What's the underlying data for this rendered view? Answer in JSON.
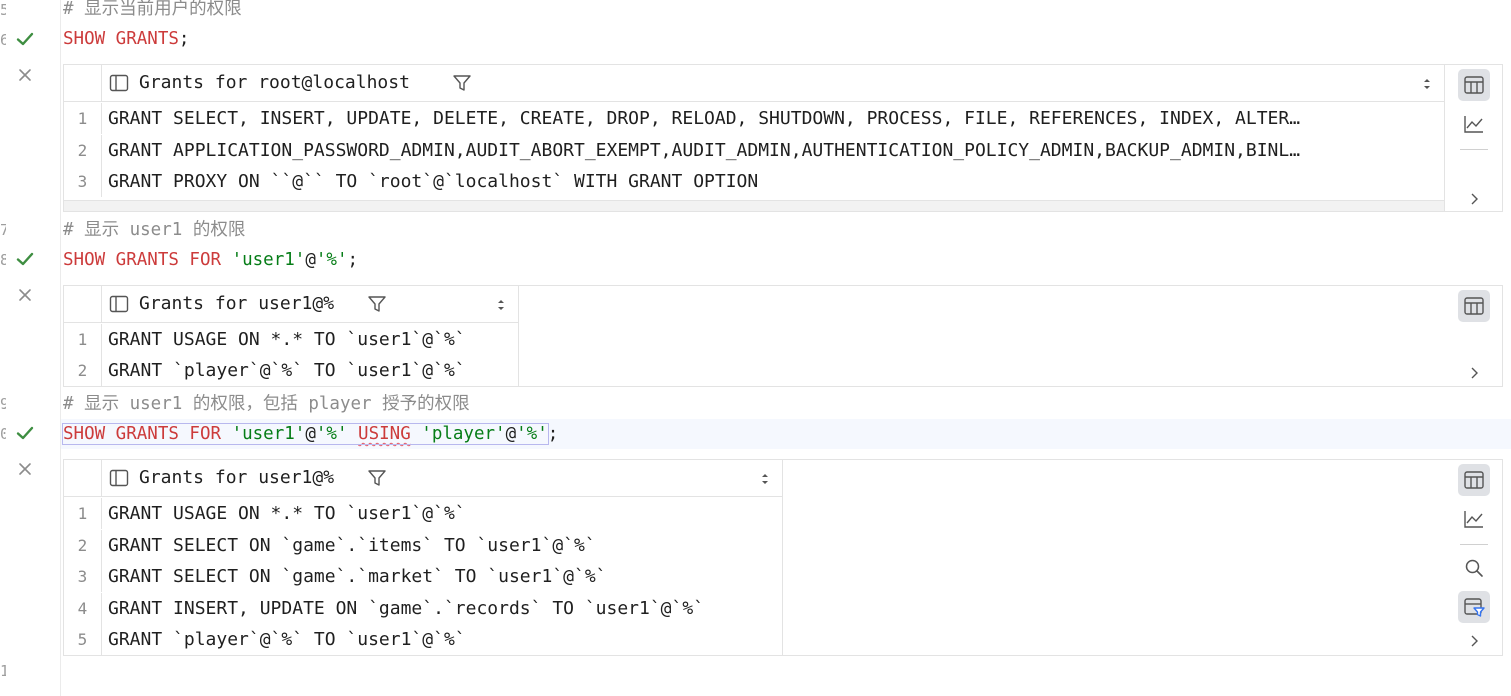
{
  "gutter": {
    "line_numbers": [
      "5",
      "6",
      "7",
      "8",
      "9",
      "0",
      "1"
    ]
  },
  "editor": {
    "line1": {
      "hash": "# ",
      "text": "显示当前用户的权限"
    },
    "line2": {
      "kw": "SHOW GRANTS",
      "end": ";"
    },
    "line3": {
      "hash": "# ",
      "text": "显示 user1 的权限"
    },
    "line4": {
      "kw1": "SHOW GRANTS FOR ",
      "s1": "'user1'",
      "at": "@",
      "s2": "'%'",
      "end": ";"
    },
    "line5": {
      "hash": "# ",
      "text": "显示 user1 的权限，包括 player 授予的权限"
    },
    "line6": {
      "kw1": "SHOW GRANTS FOR ",
      "s1": "'user1'",
      "at1": "@",
      "s2": "'%'",
      "sp": " ",
      "kw2": "USING",
      "sp2": " ",
      "s3": "'player'",
      "at2": "@",
      "s4": "'%'",
      "end": ";"
    }
  },
  "result1": {
    "column": "Grants for root@localhost",
    "rows": [
      {
        "n": "1",
        "v": "GRANT SELECT, INSERT, UPDATE, DELETE, CREATE, DROP, RELOAD, SHUTDOWN, PROCESS, FILE, REFERENCES, INDEX, ALTER…"
      },
      {
        "n": "2",
        "v": "GRANT APPLICATION_PASSWORD_ADMIN,AUDIT_ABORT_EXEMPT,AUDIT_ADMIN,AUTHENTICATION_POLICY_ADMIN,BACKUP_ADMIN,BINL…"
      },
      {
        "n": "3",
        "v": "GRANT PROXY ON ``@`` TO `root`@`localhost` WITH GRANT OPTION"
      }
    ]
  },
  "result2": {
    "column": "Grants for user1@%",
    "rows": [
      {
        "n": "1",
        "v": "GRANT USAGE ON *.* TO `user1`@`%`"
      },
      {
        "n": "2",
        "v": "GRANT `player`@`%` TO `user1`@`%`"
      }
    ]
  },
  "result3": {
    "column": "Grants for user1@%",
    "rows": [
      {
        "n": "1",
        "v": "GRANT USAGE ON *.* TO `user1`@`%`"
      },
      {
        "n": "2",
        "v": "GRANT SELECT ON `game`.`items` TO `user1`@`%`"
      },
      {
        "n": "3",
        "v": "GRANT SELECT ON `game`.`market` TO `user1`@`%`"
      },
      {
        "n": "4",
        "v": "GRANT INSERT, UPDATE ON `game`.`records` TO `user1`@`%`"
      },
      {
        "n": "5",
        "v": "GRANT `player`@`%` TO `user1`@`%`"
      }
    ]
  },
  "icons": {
    "success": "check-icon",
    "close": "close-icon",
    "table_view": "table-icon",
    "chart_view": "chart-icon",
    "search": "search-icon",
    "filter_panel": "filter-panel-icon",
    "column_filter": "funnel-icon",
    "expand": "chevron-right-icon"
  },
  "colors": {
    "keyword": "#cc3b3b",
    "string": "#067d17",
    "comment": "#8c8c8c",
    "success": "#3e8e41"
  }
}
